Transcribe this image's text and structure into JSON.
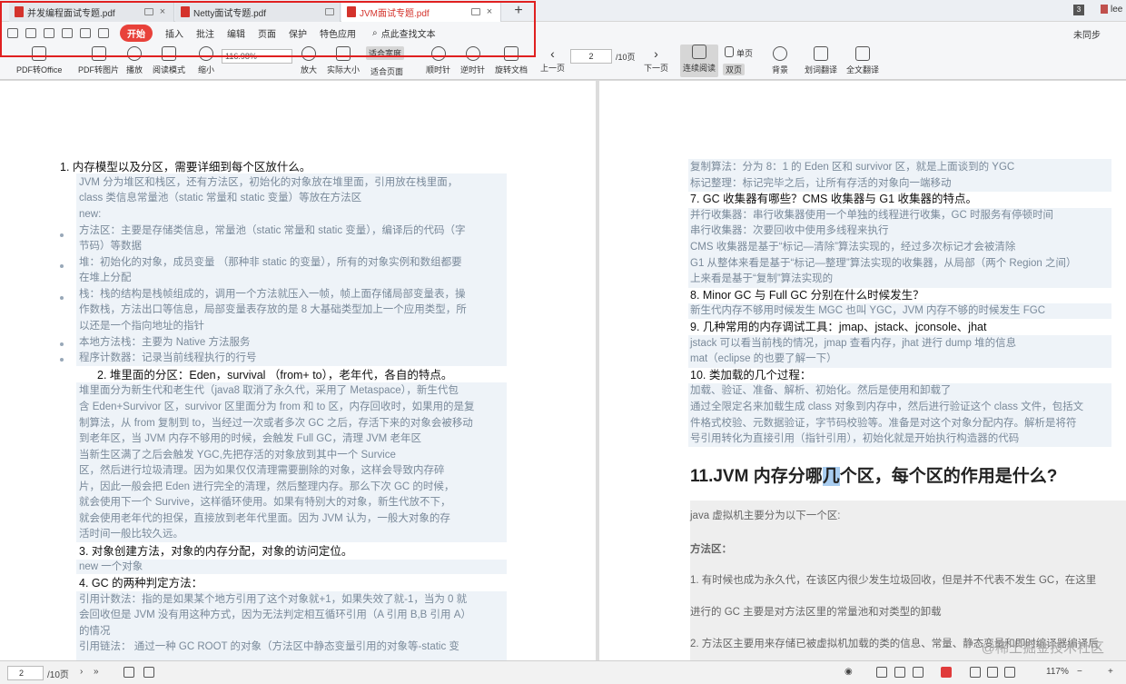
{
  "tabs": [
    {
      "label": "并发编程面试专题.pdf"
    },
    {
      "label": "Netty面试专题.pdf"
    },
    {
      "label": "JVM面试专题.pdf"
    }
  ],
  "header_right": {
    "badge": "3",
    "user": "lee"
  },
  "menu": {
    "items": [
      "开始",
      "插入",
      "批注",
      "编辑",
      "页面",
      "保护",
      "特色应用"
    ],
    "search": "点此查找文本",
    "sync": "未同步"
  },
  "toolbar": {
    "items": [
      "PDF转Office",
      "PDF转图片",
      "播放",
      "阅读模式",
      "缩小",
      "放大",
      "实际大小",
      "适合宽度",
      "适合页面",
      "顺时针",
      "逆时针",
      "旋转文档",
      "上一页",
      "下一页",
      "连续阅读",
      "单页",
      "双页",
      "背景",
      "划词翻译",
      "全文翻译"
    ],
    "zoom": "116.98%",
    "page": "2",
    "total": "/10页"
  },
  "left_page": {
    "lines": [
      "1.  内存模型以及分区，需要详细到每个区放什么。",
      "JVM 分为堆区和栈区，还有方法区，初始化的对象放在堆里面，引用放在栈里面，",
      "class 类信息常量池（static 常量和 static 变量）等放在方法区",
      "new:",
      "方法区：主要是存储类信息，常量池（static 常量和 static 变量），编译后的代码（字",
      "节码）等数据",
      "堆：初始化的对象，成员变量 （那种非 static 的变量），所有的对象实例和数组都要",
      "在堆上分配",
      "栈：栈的结构是栈帧组成的，调用一个方法就压入一帧，帧上面存储局部变量表，操",
      "作数栈，方法出口等信息，局部变量表存放的是 8 大基础类型加上一个应用类型，所",
      "以还是一个指向地址的指针",
      "本地方法栈：主要为 Native 方法服务",
      "程序计数器：记录当前线程执行的行号",
      "2.  堆里面的分区：Eden，survival （from+ to），老年代，各自的特点。",
      "堆里面分为新生代和老生代（java8 取消了永久代，采用了 Metaspace），新生代包",
      "含 Eden+Survivor 区，survivor 区里面分为 from 和 to 区，内存回收时，如果用的是复",
      "制算法，从 from 复制到 to，当经过一次或者多次 GC 之后，存活下来的对象会被移动",
      "到老年区，当 JVM 内存不够用的时候，会触发 Full GC，清理 JVM 老年区",
      "当新生区满了之后会触发 YGC,先把存活的对象放到其中一个 Survice",
      "区，然后进行垃圾清理。因为如果仅仅清理需要删除的对象，这样会导致内存碎",
      "片，因此一般会把 Eden 进行完全的清理，然后整理内存。那么下次 GC 的时候，",
      "就会使用下一个 Survive，这样循环使用。如果有特别大的对象，新生代放不下，",
      "就会使用老年代的担保，直接放到老年代里面。因为 JVM 认为，一般大对象的存",
      "活时间一般比较久远。",
      "3.  对象创建方法，对象的内存分配，对象的访问定位。",
      "new 一个对象",
      "4.  GC 的两种判定方法：",
      "引用计数法：指的是如果某个地方引用了这个对象就+1，如果失效了就-1，当为 0 就",
      "会回收但是 JVM 没有用这种方式，因为无法判定相互循环引用（A 引用 B,B 引用 A）",
      "的情况",
      "引用链法：  通过一种 GC ROOT 的对象（方法区中静态变量引用的对象等-static 变"
    ]
  },
  "right_page": {
    "lines": [
      "复制算法：分为 8：1 的 Eden 区和 survivor 区，就是上面谈到的 YGC",
      "标记整理：标记完毕之后，让所有存活的对象向一端移动",
      "7.  GC 收集器有哪些？CMS 收集器与 G1 收集器的特点。",
      "并行收集器：串行收集器使用一个单独的线程进行收集，GC 时服务有停顿时间",
      "串行收集器：次要回收中使用多线程来执行",
      "CMS 收集器是基于“标记—清除”算法实现的，经过多次标记才会被清除",
      "G1 从整体来看是基于“标记—整理”算法实现的收集器，从局部（两个 Region 之间）",
      "上来看是基于“复制”算法实现的",
      "8.  Minor GC 与 Full GC 分别在什么时候发生？",
      "新生代内存不够用时候发生 MGC 也叫 YGC，JVM 内存不够的时候发生 FGC",
      "9.  几种常用的内存调试工具：jmap、jstack、jconsole、jhat",
      "jstack 可以看当前栈的情况，jmap 查看内存，jhat 进行 dump 堆的信息",
      "mat（eclipse 的也要了解一下）",
      "10. 类加载的几个过程：",
      "加载、验证、准备、解析、初始化。然后是使用和卸载了",
      "通过全限定名来加载生成 class 对象到内存中，然后进行验证这个 class 文件，包括文",
      "件格式校验、元数据验证，字节码校验等。准备是对这个对象分配内存。解析是将符",
      "号引用转化为直接引用（指针引用），初始化就是开始执行构造器的代码"
    ],
    "title_pre": "11.JVM 内存分哪",
    "title_sel": "几",
    "title_post": "个区，每个区的作用是什么?",
    "gray_lines": [
      "java 虚拟机主要分为以下一个区:",
      "方法区：",
      "1. 有时候也成为永久代，在该区内很少发生垃圾回收，但是并不代表不发生 GC，在这里",
      "进行的 GC 主要是对方法区里的常量池和对类型的卸载",
      "2. 方法区主要用来存储已被虚拟机加载的类的信息、常量、静态变量和即时编译器编译后"
    ],
    "watermark": "@稀土掘金技术社区"
  },
  "status": {
    "page": "2",
    "total": "/10页",
    "zoom": "117%"
  }
}
